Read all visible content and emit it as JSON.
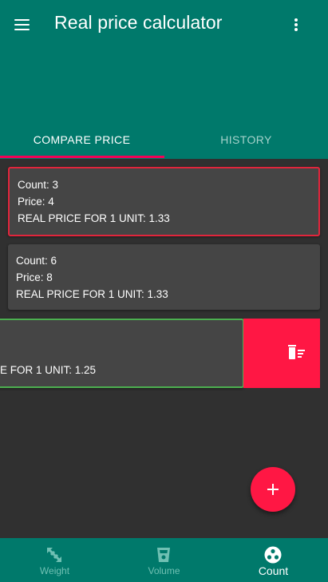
{
  "app_bar": {
    "title": "Real price calculator",
    "menu_icon": "hamburger-menu-icon",
    "more_icon": "more-vert-icon"
  },
  "tabs": [
    {
      "label": "COMPARE PRICE",
      "selected": true
    },
    {
      "label": "HISTORY",
      "selected": false
    }
  ],
  "cards": [
    {
      "count": "Count: 3",
      "price": "Price: 4",
      "real_price": "REAL PRICE FOR 1 UNIT: 1.33",
      "state": "highlighted-red"
    },
    {
      "count": "Count: 6",
      "price": "Price: 8",
      "real_price": "REAL PRICE FOR 1 UNIT: 1.33",
      "state": "normal"
    },
    {
      "real_price_partial": "E FOR 1 UNIT: 1.25",
      "state": "highlighted-green-swiped"
    }
  ],
  "delete_action": {
    "icon": "delete-sweep-icon"
  },
  "fab": {
    "icon": "plus-icon"
  },
  "bottom_nav": [
    {
      "label": "Weight",
      "icon": "weight-arrows-icon",
      "active": false
    },
    {
      "label": "Volume",
      "icon": "cup-icon",
      "active": false
    },
    {
      "label": "Count",
      "icon": "count-dots-icon",
      "active": true
    }
  ],
  "colors": {
    "primary": "#00796B",
    "accent": "#FF1744",
    "background": "#303030",
    "card": "#454545",
    "highlight_red": "#E2253C",
    "highlight_green": "#4CAF50"
  }
}
